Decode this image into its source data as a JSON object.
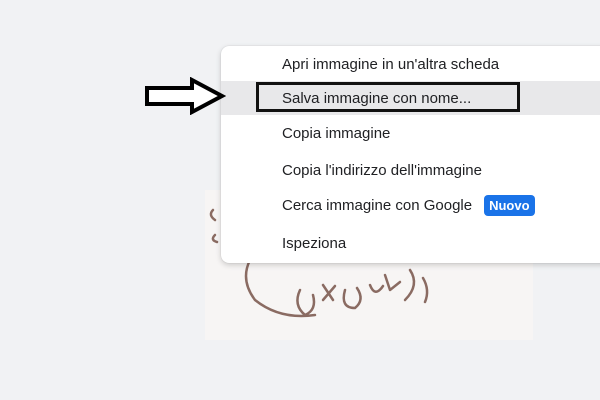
{
  "context_menu": {
    "items": [
      {
        "label": "Apri immagine in un'altra scheda"
      },
      {
        "label": "Salva immagine con nome..."
      },
      {
        "label": "Copia immagine"
      },
      {
        "label": "Copia l'indirizzo dell'immagine"
      },
      {
        "label": "Cerca immagine con Google",
        "badge": "Nuovo"
      },
      {
        "label": "Ispeziona"
      }
    ],
    "hovered_index": 1
  },
  "colors": {
    "badge_background": "#1a73e8",
    "highlight_box": "#111111",
    "hover_background": "#e8e8ea",
    "drawing_stroke": "#8a6b62"
  },
  "annotation": {
    "arrow_icon": "right-arrow-outline-icon"
  }
}
